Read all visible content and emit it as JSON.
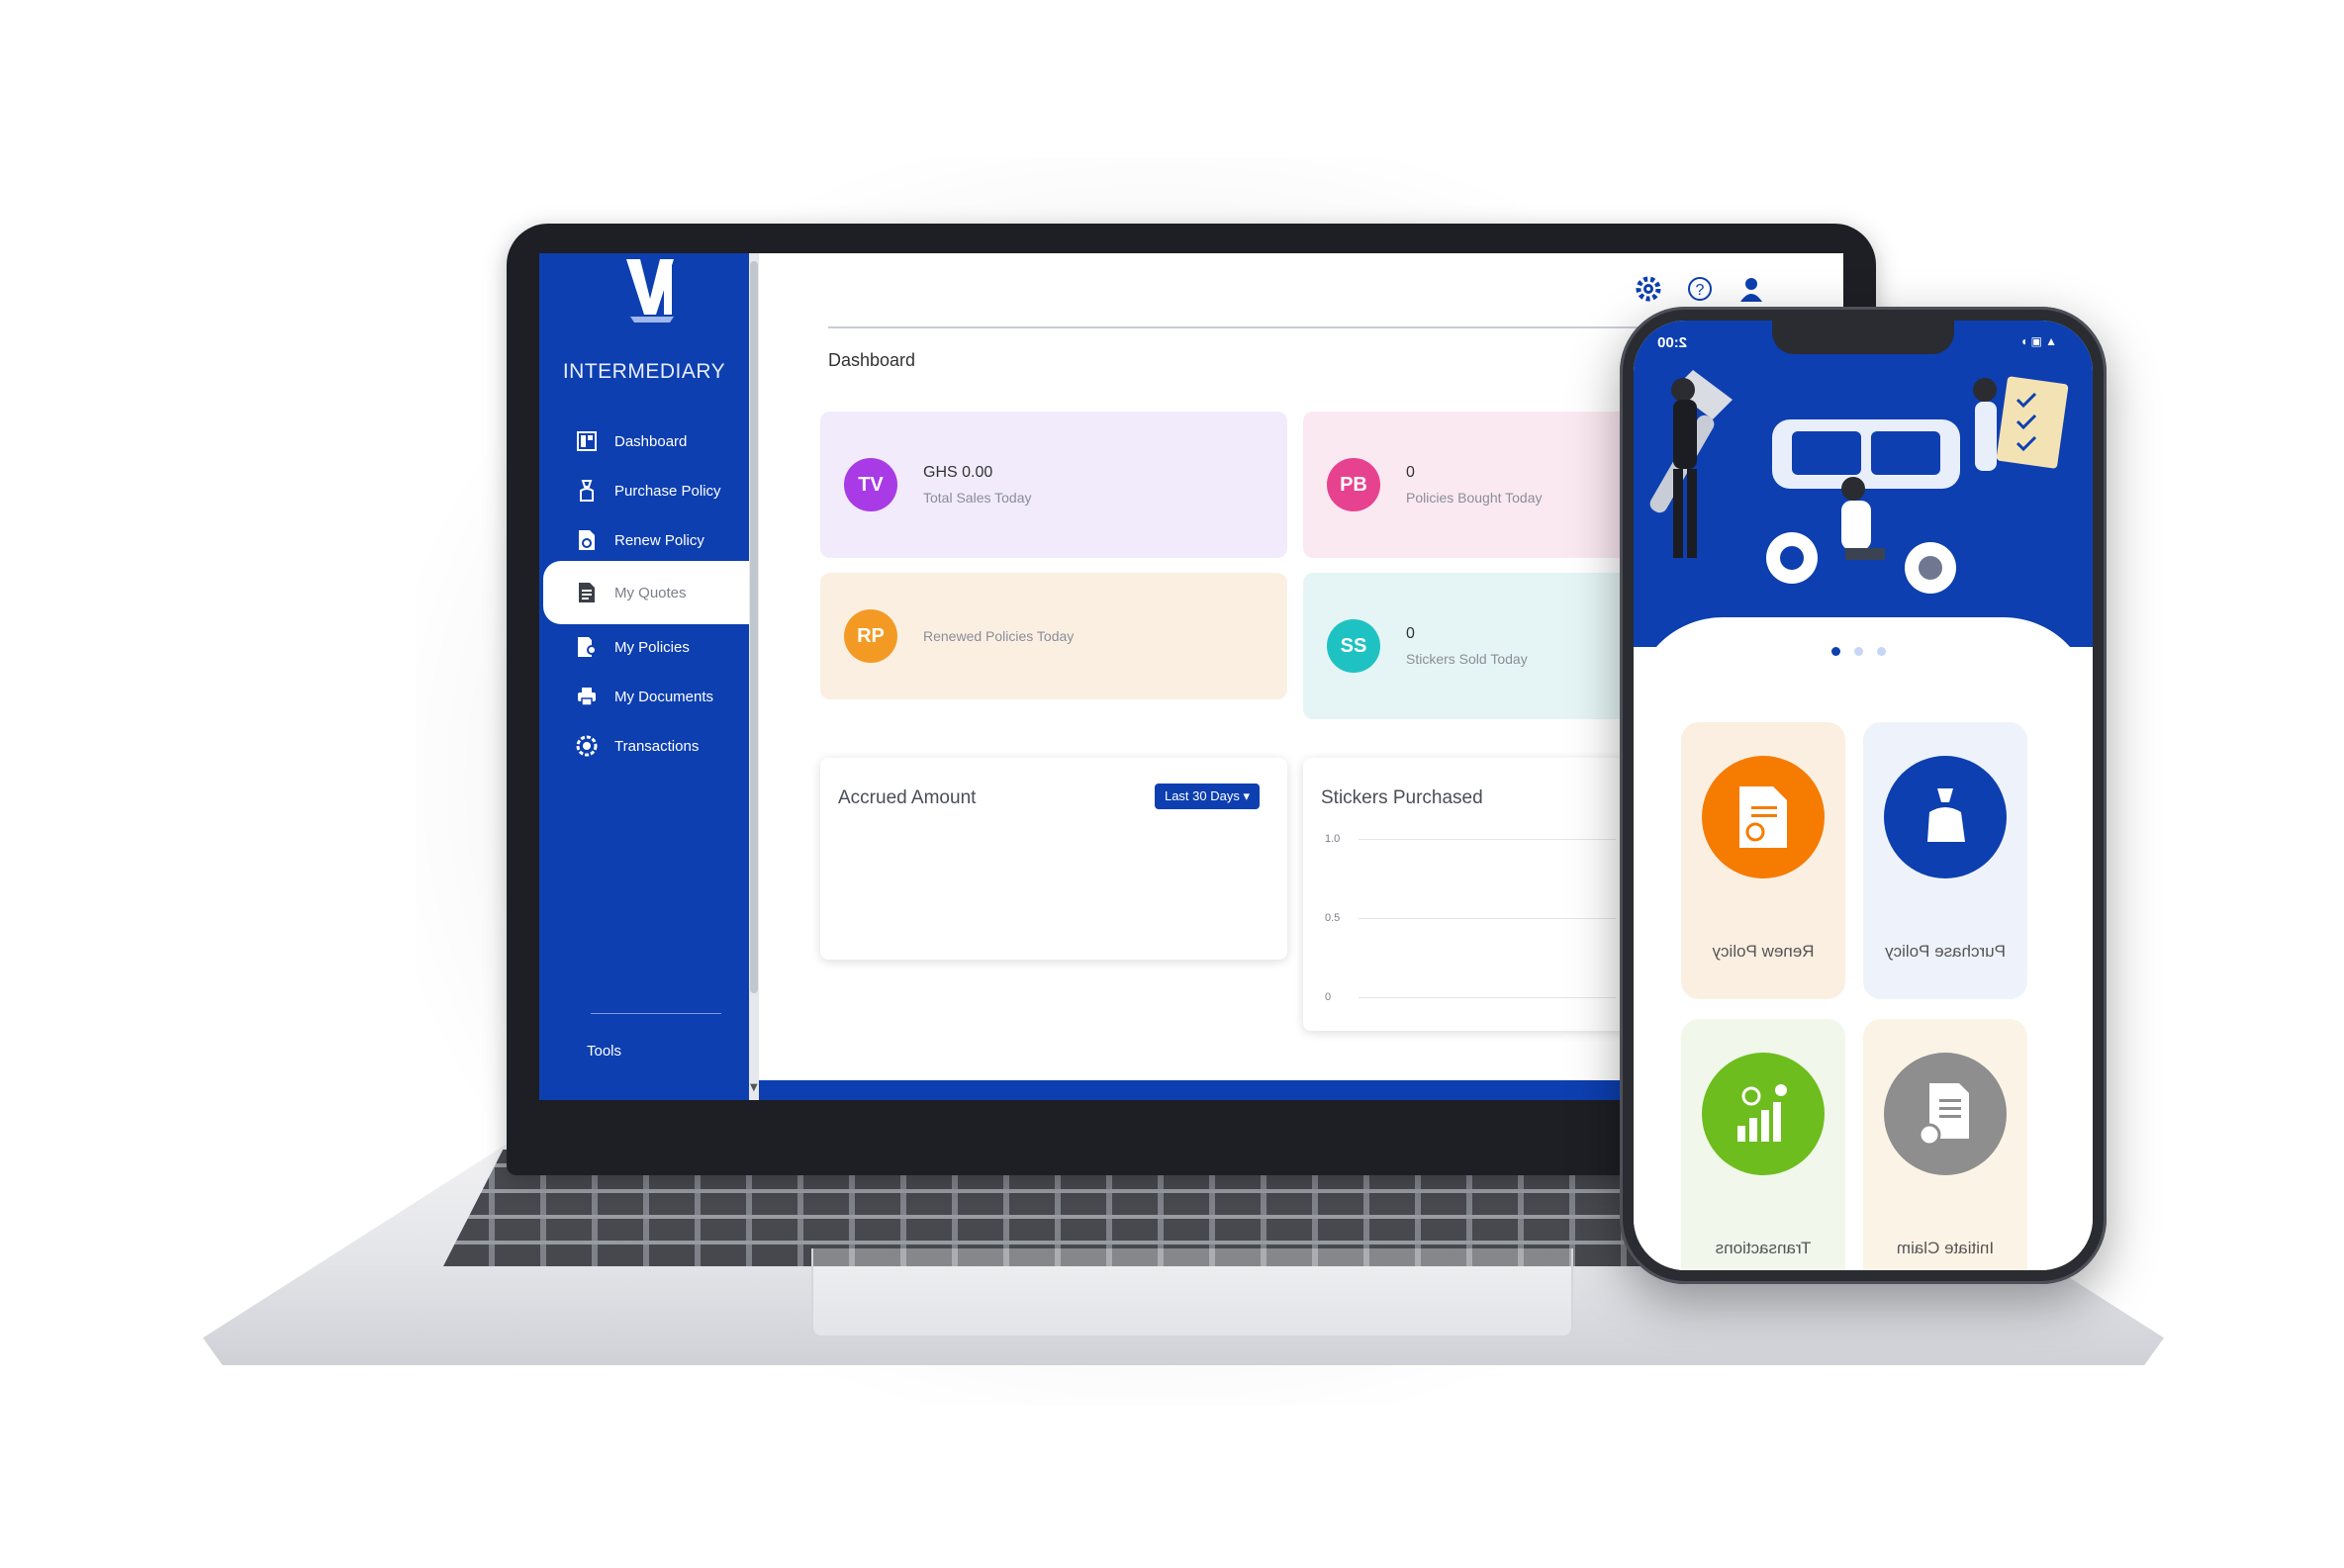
{
  "desktop": {
    "brand": "INTERMEDIARY",
    "sidebar": {
      "items": [
        {
          "label": "Dashboard",
          "icon": "dashboard-icon"
        },
        {
          "label": "Purchase Policy",
          "icon": "hand-money-icon"
        },
        {
          "label": "Renew Policy",
          "icon": "document-refresh-icon"
        },
        {
          "label": "My Quotes",
          "icon": "quote-document-icon",
          "active": true
        },
        {
          "label": "My Policies",
          "icon": "policies-icon"
        },
        {
          "label": "My Documents",
          "icon": "printer-icon"
        },
        {
          "label": "Transactions",
          "icon": "gear-badge-icon"
        }
      ],
      "tools": "Tools"
    },
    "page_title": "Dashboard",
    "stats": [
      {
        "badge": "TV",
        "value": "GHS 0.00",
        "label": "Total Sales Today",
        "badge_color": "#a83be6",
        "bg": "#f1ebfb"
      },
      {
        "badge": "PB",
        "value": "0",
        "label": "Policies Bought Today",
        "badge_color": "#e7428f",
        "bg": "#fbe9f1"
      },
      {
        "badge": "RP",
        "value": "",
        "label": "Renewed Policies Today",
        "badge_color": "#f39a25",
        "bg": "#fbefe2"
      },
      {
        "badge": "SS",
        "value": "0",
        "label": "Stickers Sold Today",
        "badge_color": "#1fc2c2",
        "bg": "#e5f5f5"
      }
    ],
    "accrued": {
      "title": "Accrued Amount",
      "range": "Last 30 Days"
    },
    "stickers": {
      "title": "Stickers Purchased",
      "y_ticks": [
        "1.0",
        "0.5",
        "0"
      ]
    }
  },
  "mobile": {
    "status": {
      "time": "2:00",
      "left_icons": "◖ ▣ ▲"
    },
    "tiles": [
      {
        "label": "Purchase Policy",
        "color": "#0d3fb0",
        "bg": "#eef3fb"
      },
      {
        "label": "Renew Policy",
        "color": "#f57c00",
        "bg": "#fbefe2"
      },
      {
        "label": "Initiate Claim",
        "color": "#8e8e8e",
        "bg": "#fbf4e6"
      },
      {
        "label": "Transactions",
        "color": "#6dbd1e",
        "bg": "#f1f7ea"
      }
    ]
  },
  "colors": {
    "brand_blue": "#0d3fb0"
  }
}
